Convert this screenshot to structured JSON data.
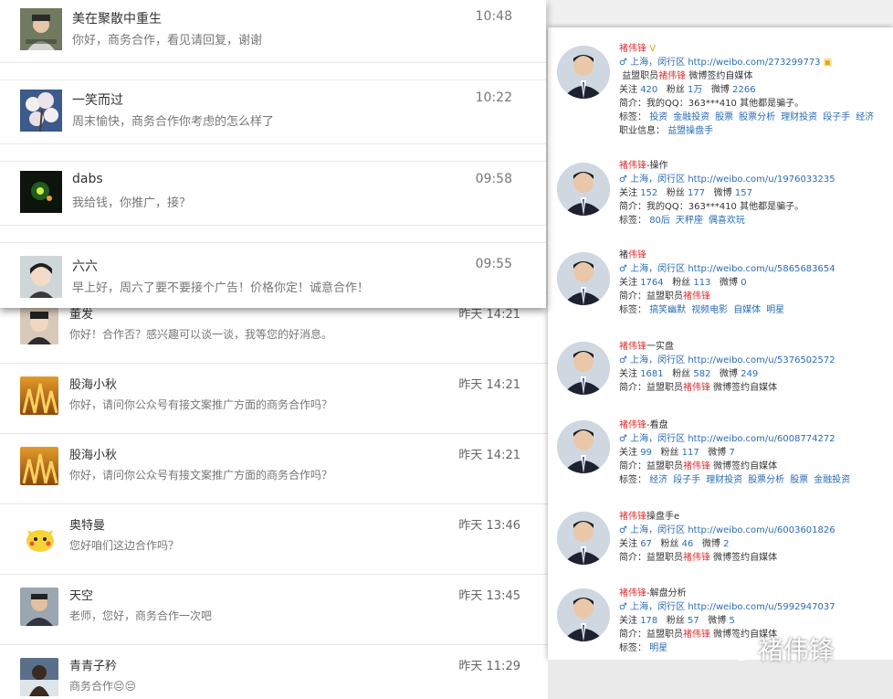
{
  "front_messages": [
    {
      "name": "美在聚散中重生",
      "time": "10:48",
      "msg": "你好，商务合作，看见请回复，谢谢"
    },
    {
      "name": "一笑而过",
      "time": "10:22",
      "msg": "周末愉快，商务合作你考虑的怎么样了"
    },
    {
      "name": "dabs",
      "time": "09:58",
      "msg": "我给钱，你推广，接？"
    },
    {
      "name": "六六",
      "time": "09:55",
      "msg": "早上好，周六了要不要接个广告！价格你定！诚意合作！"
    }
  ],
  "back_messages": [
    {
      "name": "董发",
      "time": "昨天 14:21",
      "msg": "你好！合作否？感兴趣可以谈一谈，我等您的好消息。"
    },
    {
      "name": "股海小秋",
      "time": "昨天 14:21",
      "msg": "你好，请问你公众号有接文案推广方面的商务合作吗？"
    },
    {
      "name": "股海小秋",
      "time": "昨天 14:21",
      "msg": "你好，请问你公众号有接文案推广方面的商务合作吗？"
    },
    {
      "name": "奥特曼",
      "time": "昨天 13:46",
      "msg": "您好咱们这边合作吗？"
    },
    {
      "name": "天空",
      "time": "昨天 13:45",
      "msg": "老师，您好，商务合作一次吧"
    },
    {
      "name": "青青子矜",
      "time": "昨天 11:29",
      "msg": "商务合作😔😔"
    }
  ],
  "profiles": [
    {
      "name_red": "褚伟锋",
      "name_black": "",
      "location": "♂ 上海，闵行区",
      "url": "http://weibo.com/273299773",
      "follow": "420",
      "fans": "1万",
      "weibo": "2266",
      "intro_pre": "简介：我的QQ：363***410 其他都是骗子。",
      "tags": [
        "投资",
        "金融投资",
        "股票",
        "股票分析",
        "理财投资",
        "段子手",
        "经济"
      ],
      "job": "益盟操盘手",
      "verify_pre": "益盟职员",
      "verify_red": "褚伟锋",
      "verify_post": " 微博签约自媒体"
    },
    {
      "name_red": "褚伟锋",
      "name_black": "-操作",
      "location": "♂ 上海，闵行区",
      "url": "http://weibo.com/u/1976033235",
      "follow": "152",
      "fans": "177",
      "weibo": "157",
      "intro_pre": "简介：我的QQ：363***410 其他都是骗子。",
      "tags": [
        "80后",
        "天秤座",
        "偶喜欢玩"
      ]
    },
    {
      "name_red": "伟锋",
      "name_black": "褚",
      "location": "♂ 上海，闵行区",
      "url": "http://weibo.com/u/5865683654",
      "follow": "1764",
      "fans": "113",
      "weibo": "0",
      "intro_pre": "简介：益盟职员",
      "intro_red": "褚伟锋",
      "tags": [
        "搞笑幽默",
        "视频电影",
        "自媒体",
        "明星"
      ]
    },
    {
      "name_red": "褚伟锋",
      "name_black": "一实盘",
      "location": "♂ 上海，闵行区",
      "url": "http://weibo.com/u/5376502572",
      "follow": "1681",
      "fans": "582",
      "weibo": "249",
      "intro_pre": "简介：益盟职员",
      "intro_red": "褚伟锋",
      "intro_post": " 微博签约自媒体"
    },
    {
      "name_red": "褚伟锋",
      "name_black": "-看盘",
      "location": "♂ 上海，闵行区",
      "url": "http://weibo.com/u/6008774272",
      "follow": "99",
      "fans": "117",
      "weibo": "7",
      "intro_pre": "简介：益盟职员",
      "intro_red": "褚伟锋",
      "intro_post": " 微博签约自媒体",
      "tags": [
        "经济",
        "段子手",
        "理财投资",
        "股票分析",
        "股票",
        "金融投资"
      ]
    },
    {
      "name_red": "褚伟锋",
      "name_black": "操盘手e",
      "location": "♂ 上海，闵行区",
      "url": "http://weibo.com/u/6003601826",
      "follow": "67",
      "fans": "46",
      "weibo": "2",
      "intro_pre": "简介：益盟职员",
      "intro_red": "褚伟锋",
      "intro_post": " 微博签约自媒体"
    },
    {
      "name_red": "褚伟锋",
      "name_black": "-解盘分析",
      "location": "♂ 上海，闵行区",
      "url": "http://weibo.com/u/5992947037",
      "follow": "178",
      "fans": "57",
      "weibo": "5",
      "intro_pre": "简介：益盟职员",
      "intro_red": "褚伟锋",
      "intro_post": " 微博签约自媒体",
      "tags": [
        "明星"
      ]
    }
  ],
  "labels": {
    "follow": "关注",
    "fans": "粉丝",
    "weibo": "微博",
    "tags": "标签：",
    "job": "职业信息："
  },
  "watermark": "褚伟锋"
}
